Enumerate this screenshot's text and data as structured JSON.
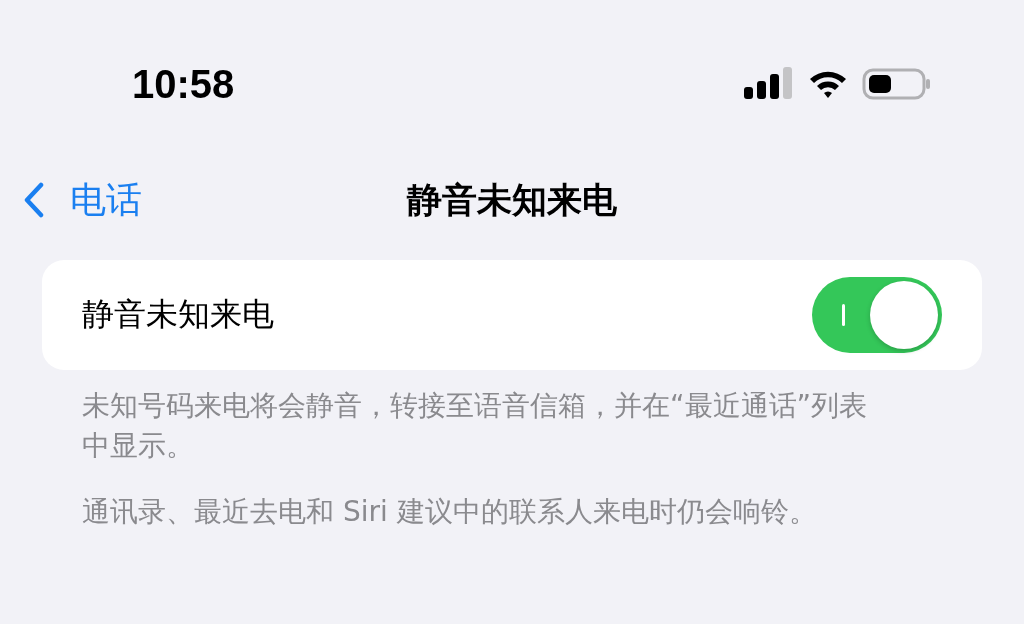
{
  "status_bar": {
    "time": "10:58"
  },
  "nav": {
    "back_label": "电话",
    "title": "静音未知来电"
  },
  "settings": [
    {
      "label": "静音未知来电",
      "on": true
    }
  ],
  "footer_notes": [
    "未知号码来电将会静音，转接至语音信箱，并在“最近通话”列表中显示。",
    "通讯录、最近去电和 Siri 建议中的联系人来电时仍会响铃。"
  ]
}
